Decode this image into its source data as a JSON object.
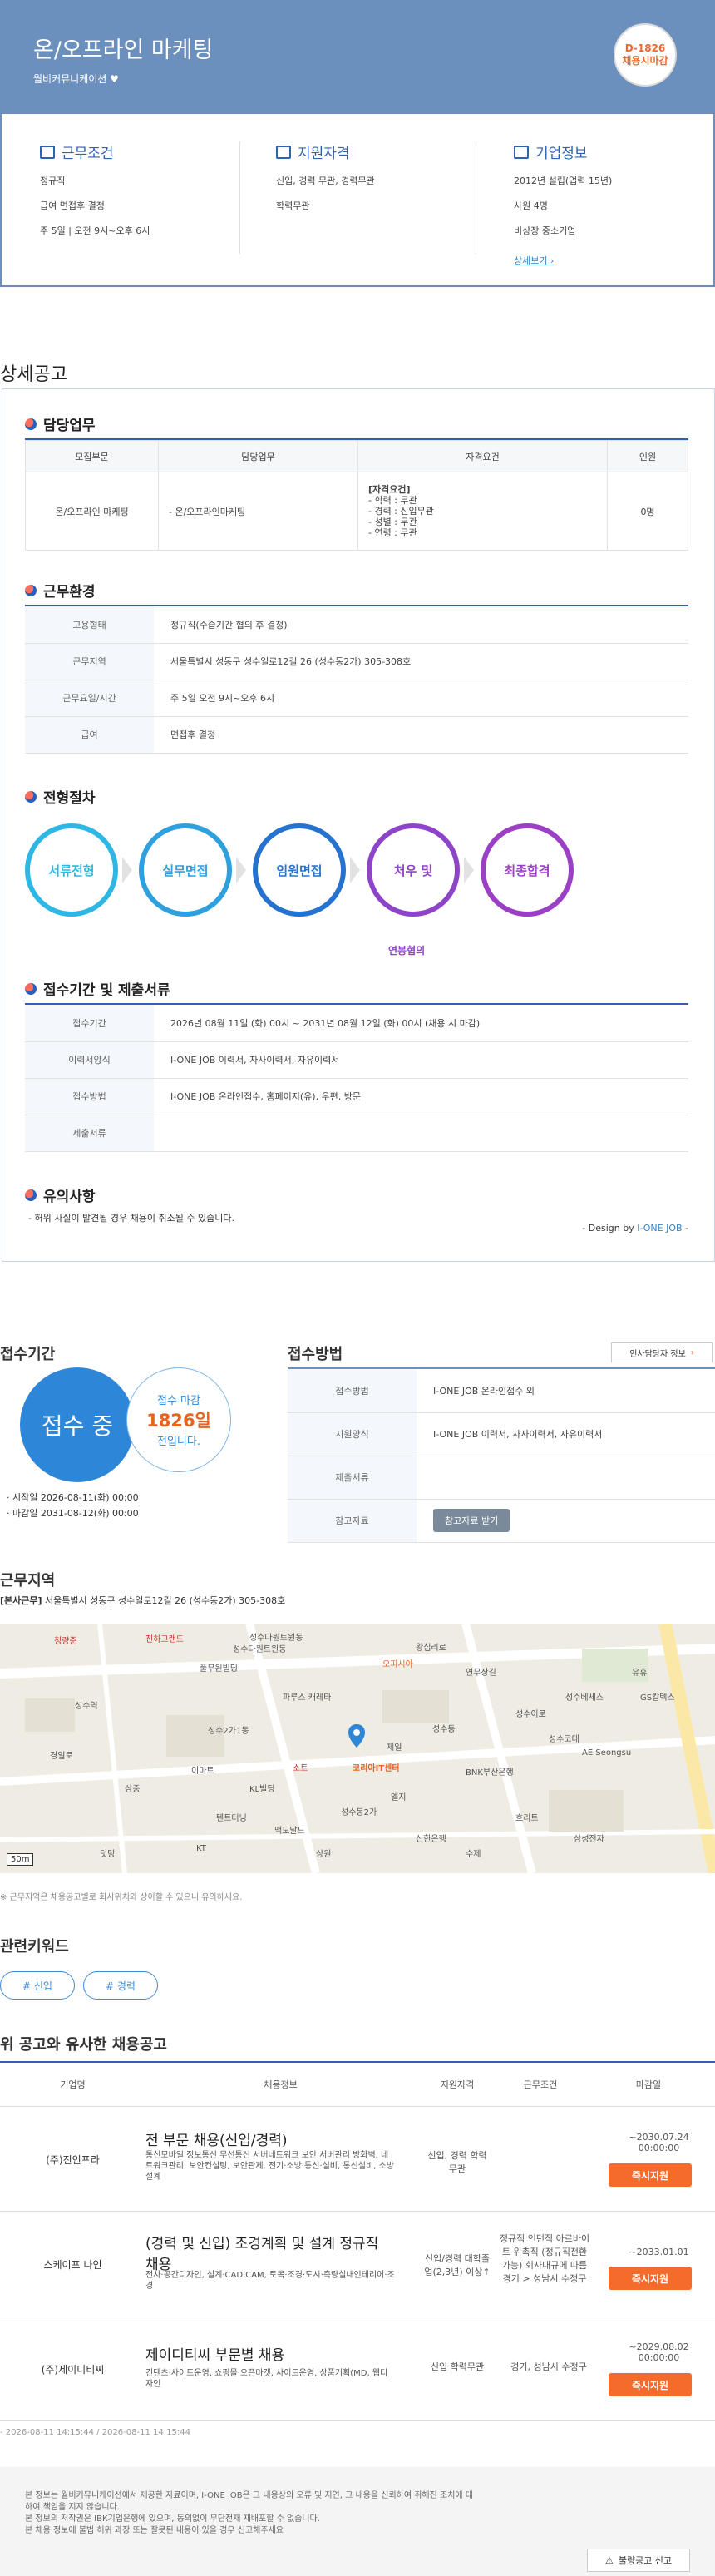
{
  "header": {
    "title": "온/오프라인 마케팅",
    "company": "월비커뮤니케이션 ♥",
    "dday": "D-1826",
    "dday_label": "채용시마감"
  },
  "summary": [
    {
      "title": "근무조건",
      "lines": [
        "정규직",
        "급여 면접후 결정",
        "주 5일 | 오전 9시~오후 6시"
      ]
    },
    {
      "title": "지원자격",
      "lines": [
        "신입, 경력 무관, 경력무관",
        "학력무관"
      ]
    },
    {
      "title": "기업정보",
      "lines": [
        "2012년 설립(업력 15년)",
        "사원 4명",
        "비상장 중소기업"
      ],
      "link": "상세보기 ›"
    }
  ],
  "detail_title": "상세공고",
  "duty": {
    "title": "담당업무",
    "headers": [
      "모집부문",
      "담당업무",
      "자격요건",
      "인원"
    ],
    "row": {
      "dept": "온/오프라인 마케팅",
      "task": "- 온/오프라인마케팅",
      "req_title": "[자격요건]",
      "req": [
        "- 학력 : 무관",
        "- 경력 : 신입무관",
        "- 성별 : 무관",
        "- 연령 : 무관"
      ],
      "count": "0명"
    }
  },
  "env": {
    "title": "근무환경",
    "rows": [
      {
        "k": "고용형태",
        "v": "정규직(수습기간 협의 후 결정)"
      },
      {
        "k": "근무지역",
        "v": "서울특별시 성동구 성수일로12길 26 (성수동2가) 305-308호"
      },
      {
        "k": "근무요일/시간",
        "v": "주 5일 오전 9시~오후 6시"
      },
      {
        "k": "급여",
        "v": "면접후 결정"
      }
    ]
  },
  "process": {
    "title": "전형절차",
    "steps": [
      {
        "label": "서류전형",
        "color": "#2fb7e4"
      },
      {
        "label": "실무면접",
        "color": "#2da0dd"
      },
      {
        "label": "임원면접",
        "color": "#2672cf"
      },
      {
        "label": "처우 및",
        "color": "#8e44c9"
      },
      {
        "label": "최종합격",
        "color": "#9b3fc4"
      }
    ],
    "note": "연봉협의"
  },
  "period": {
    "title": "접수기간 및 제출서류",
    "rows": [
      {
        "k": "접수기간",
        "v": "2026년 08월 11일 (화) 00시 ~ 2031년 08월 12일 (화) 00시 (채용 시 마감)"
      },
      {
        "k": "이력서양식",
        "v": "I-ONE JOB 이력서, 자사이력서, 자유이력서"
      },
      {
        "k": "접수방법",
        "v": "I-ONE JOB 온라인접수, 홈페이지(유), 우편, 방문"
      },
      {
        "k": "제출서류",
        "v": ""
      }
    ]
  },
  "caution": {
    "title": "유의사항",
    "text": "- 허위 사실이 발견될 경우 채용이 취소될 수 있습니다.",
    "design_prefix": "- Design by ",
    "design_brand": "I-ONE JOB",
    "design_suffix": " -"
  },
  "receipt": {
    "title": "접수기간",
    "status": "접수 중",
    "deadline_label": "접수 마감",
    "days": "1826일",
    "days_suffix": "전입니다.",
    "start": "· 시작일 2026-08-11(화) 00:00",
    "end": "· 마감일 2031-08-12(화) 00:00"
  },
  "method": {
    "title": "접수방법",
    "hr_btn": "인사담당자 정보",
    "rows": [
      {
        "k": "접수방법",
        "v": "I-ONE JOB 온라인접수 외"
      },
      {
        "k": "지원양식",
        "v": "I-ONE JOB 이력서, 자사이력서, 자유이력서"
      },
      {
        "k": "제출서류",
        "v": ""
      },
      {
        "k": "참고자료",
        "v": "참고자료 받기"
      }
    ]
  },
  "location": {
    "title": "근무지역",
    "addr_tag": "[본사근무]",
    "addr": " 서울특별시 성동구 성수일로12길 26 (성수동2가) 305-308호",
    "note": "※ 근무지역은 채용공고별로 회사위치와 상이할 수 있으니 유의하세요.",
    "pin": "코리아IT센터",
    "scale": "50m"
  },
  "map_labels": [
    "청량준",
    "진하그랜드",
    "성수다원트윈동",
    "성수다원트윈동",
    "풀무원빌딩",
    "성수역",
    "왕십리로",
    "연무장길",
    "파루스 캐레타",
    "성수2가1동",
    "성수동",
    "성수이로",
    "경일로",
    "소트",
    "코리아IT센터",
    "제일",
    "KL빌딩",
    "엘지",
    "BNK부산은행",
    "AE Seongsu",
    "성수베세스",
    "유휴",
    "삼중",
    "이마트",
    "신한은행",
    "GS칼텍스",
    "흐리트",
    "성수코대",
    "오피시아",
    "성수동2가",
    "텐트터닝",
    "삼성전자",
    "맥도날드",
    "KT",
    "상원",
    "수제",
    "덧탕"
  ],
  "keywords": {
    "title": "관련키워드",
    "items": [
      "# 신입",
      "# 경력"
    ]
  },
  "similar": {
    "title": "위 공고와 유사한 채용공고",
    "headers": [
      "기업명",
      "채용정보",
      "지원자격",
      "근무조건",
      "마감일"
    ],
    "rows": [
      {
        "company": "(주)진인프라",
        "title": "전 부문 채용(신입/경력)",
        "desc": "통신모바일 정보통신 무선통신 서버네트워크 보안 서버관리 방화벽, 네트워크관리, 보안컨설팅, 보안관제, 전기·소방·통신·설비, 통신설비, 소방설계",
        "qual": "신입, 경력 학력무관",
        "cond": "",
        "deadline": "~2030.07.24 00:00:00",
        "apply": "즉시지원"
      },
      {
        "company": "스케이프 나인",
        "title": "(경력 및 신입) 조경계획 및 설계 정규직 채용",
        "desc": "전사·공간디자인, 설계·CAD·CAM, 토목·조경·도시·측량실내인테리어·조경",
        "qual": "신입/경력 대학졸업(2,3년) 이상↑",
        "cond": "정규직 인턴직 아르바이트 위촉직 (정규직전환가능) 회사내규에 따름 경기 > 성남시 수정구",
        "deadline": "~2033.01.01",
        "apply": "즉시지원"
      },
      {
        "company": "(주)제이디티씨",
        "title": "제이디티씨 부문별 채용",
        "desc": "컨텐츠·사이트운영, 쇼핑몰·오픈마켓, 사이트운영, 상품기획(MD, 웹디자인",
        "qual": "신입 학력무관",
        "cond": "경기, 성남시 수정구",
        "deadline": "~2029.08.02 00:00:00",
        "apply": "즉시지원"
      }
    ]
  },
  "timestamps": "- 2026-08-11 14:15:44 / 2026-08-11 14:15:44",
  "footer": {
    "notes": [
      "본 정보는 월비커뮤니케이션에서 제공한 자료이며, I-ONE JOB은 그 내용상의 오류 및 지연, 그 내용을 신뢰하여 취해진 조치에 대하여 책임을 지지 않습니다.",
      "본 정보의 저작권은 IBK기업은행에 있으며, 동의없이 무단전재 재배포할 수 없습니다.",
      "본 채용 정보에 불법 허위 과장 또는 잘못된 내용이 있을 경우 신고해주세요"
    ],
    "report_btn": "불량공고 신고"
  }
}
